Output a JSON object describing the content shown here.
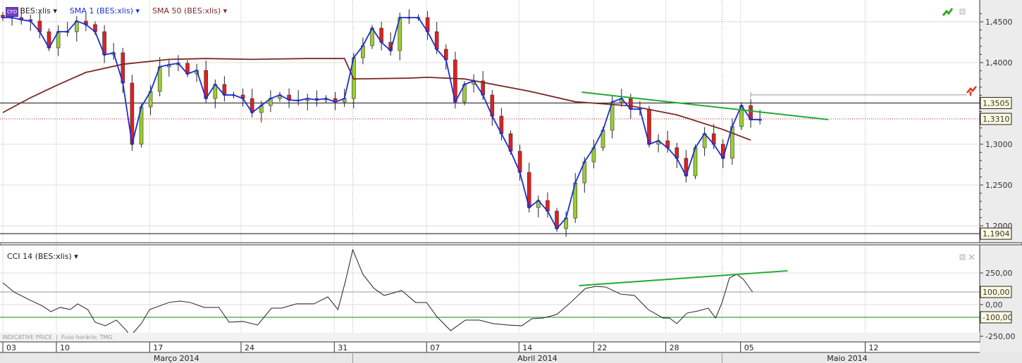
{
  "legend": {
    "badge": "CFD",
    "instrument": "BES:xlis",
    "sma1": "SMA 1 (BES:xlis)",
    "sma50": "SMA 50 (BES:xlis)",
    "arrow": "▾"
  },
  "cci_legend": "CCI 14 (BES:xlis)",
  "info": {
    "price_type": "INDICATIVE PRICE",
    "timezone": "Fuso horário: TMG"
  },
  "colors": {
    "up": "#9acd32",
    "down": "#e02020",
    "sma1": "#1a2ed8",
    "sma50": "#7a2a2a",
    "trend": "#22aa33",
    "cci": "#222222"
  },
  "chart_data": [
    {
      "type": "candlestick",
      "title": "BES:xlis",
      "ylim": [
        1.18,
        1.465
      ],
      "y_ticks": [
        "1,4500",
        "1,4000",
        "1,3000",
        "1,2500",
        "1,2000"
      ],
      "y_tick_values": [
        1.45,
        1.4,
        1.3,
        1.25,
        1.2
      ],
      "closes": [
        1.4552,
        1.4552,
        1.4526,
        1.4509,
        1.4379,
        1.4181,
        1.4379,
        1.4379,
        1.4509,
        1.4466,
        1.4379,
        1.4095,
        1.4121,
        1.375,
        1.3,
        1.3457,
        1.3647,
        1.3948,
        1.3974,
        1.3991,
        1.3862,
        1.3905,
        1.356,
        1.3733,
        1.3603,
        1.3603,
        1.356,
        1.3388,
        1.3474,
        1.356,
        1.3603,
        1.3543,
        1.3534,
        1.356,
        1.3543,
        1.356,
        1.3517,
        1.356,
        1.406,
        1.4207,
        1.4422,
        1.425,
        1.4147,
        1.4552,
        1.4552,
        1.4552,
        1.4379,
        1.4164,
        1.4034,
        1.3517,
        1.3733,
        1.3776,
        1.3603,
        1.3345,
        1.3129,
        1.2914,
        1.2655,
        1.2224,
        1.231,
        1.2181,
        1.1966,
        1.2095,
        1.2526,
        1.2784,
        1.2957,
        1.3172,
        1.3517,
        1.356,
        1.3431,
        1.3431,
        1.3,
        1.3043,
        1.2957,
        1.2828,
        1.2612,
        1.2957,
        1.3129,
        1.3,
        1.2828,
        1.3216,
        1.3474,
        1.3302,
        1.3302
      ],
      "sma50": [
        [
          0,
          1.3388
        ],
        [
          3,
          1.357
        ],
        [
          6,
          1.373
        ],
        [
          9,
          1.388
        ],
        [
          13,
          1.398
        ],
        [
          18,
          1.404
        ],
        [
          22,
          1.405
        ],
        [
          27,
          1.404
        ],
        [
          33,
          1.405
        ],
        [
          37,
          1.405
        ],
        [
          38,
          1.38
        ],
        [
          44,
          1.381
        ],
        [
          46,
          1.382
        ],
        [
          50,
          1.38
        ],
        [
          57,
          1.365
        ],
        [
          62,
          1.352
        ],
        [
          68,
          1.347
        ],
        [
          73,
          1.336
        ],
        [
          78,
          1.318
        ],
        [
          81,
          1.305
        ]
      ],
      "hlines": [
        {
          "value": 1.3505,
          "label": "1,3505",
          "style": "solid"
        },
        {
          "value": 1.331,
          "label": "1,3310",
          "style": "dotted"
        },
        {
          "value": 1.1904,
          "label": "1,1904",
          "style": "solid"
        }
      ],
      "alert_line": {
        "value": 1.3605,
        "from_bar": 81
      },
      "trendline": [
        [
          62.7,
          1.3638
        ],
        [
          89.4,
          1.3302
        ]
      ]
    },
    {
      "type": "line",
      "title": "CCI 14 (BES:xlis)",
      "ylim": [
        -330,
        330
      ],
      "y_ticks": [
        "250,00",
        "0,00",
        "-250,00"
      ],
      "y_tick_values": [
        250,
        0,
        -250
      ],
      "levels": [
        {
          "value": 100,
          "label": "100,00",
          "color": "#cc1111"
        },
        {
          "value": -100,
          "label": "-100,00",
          "color": "#118811"
        }
      ],
      "points": [
        [
          0,
          172
        ],
        [
          1.2,
          100
        ],
        [
          2.7,
          44
        ],
        [
          4.3,
          -11
        ],
        [
          5.2,
          -56
        ],
        [
          6.2,
          -22
        ],
        [
          7.3,
          -39
        ],
        [
          8.1,
          6
        ],
        [
          9.2,
          -39
        ],
        [
          10,
          -139
        ],
        [
          11.1,
          -167
        ],
        [
          12.3,
          -122
        ],
        [
          13.4,
          -206
        ],
        [
          13.8,
          -250
        ],
        [
          15,
          -150
        ],
        [
          15.9,
          -39
        ],
        [
          18,
          17
        ],
        [
          19.2,
          28
        ],
        [
          20.3,
          17
        ],
        [
          21.8,
          -22
        ],
        [
          23.4,
          -22
        ],
        [
          24.5,
          -139
        ],
        [
          26,
          -133
        ],
        [
          27.6,
          -161
        ],
        [
          29.1,
          -28
        ],
        [
          30.2,
          -28
        ],
        [
          31.8,
          6
        ],
        [
          33.7,
          6
        ],
        [
          35.2,
          61
        ],
        [
          36.3,
          -39
        ],
        [
          37.1,
          183
        ],
        [
          37.9,
          433
        ],
        [
          39,
          239
        ],
        [
          40.2,
          128
        ],
        [
          41.3,
          72
        ],
        [
          43.2,
          111
        ],
        [
          44.7,
          17
        ],
        [
          45.9,
          17
        ],
        [
          47,
          -94
        ],
        [
          48.5,
          -206
        ],
        [
          50.1,
          -122
        ],
        [
          51.6,
          -122
        ],
        [
          53.1,
          -150
        ],
        [
          54.7,
          -161
        ],
        [
          56.2,
          -167
        ],
        [
          57.3,
          -111
        ],
        [
          58.5,
          -106
        ],
        [
          60,
          -78
        ],
        [
          61.5,
          17
        ],
        [
          63.1,
          128
        ],
        [
          64.2,
          144
        ],
        [
          65.3,
          139
        ],
        [
          66.9,
          83
        ],
        [
          68.4,
          72
        ],
        [
          69.9,
          -39
        ],
        [
          71.5,
          -106
        ],
        [
          72.2,
          -106
        ],
        [
          73,
          -150
        ],
        [
          74.1,
          -67
        ],
        [
          75.3,
          -50
        ],
        [
          76.4,
          -28
        ],
        [
          77.2,
          -106
        ],
        [
          77.9,
          17
        ],
        [
          78.7,
          211
        ],
        [
          79.5,
          239
        ],
        [
          80.2,
          200
        ],
        [
          81.2,
          100
        ]
      ],
      "trendline": [
        [
          62.4,
          150
        ],
        [
          85,
          267
        ]
      ]
    },
    {
      "type": "axis",
      "dates": [
        {
          "label": "03",
          "bar": 0
        },
        {
          "label": "10",
          "bar": 5.8
        },
        {
          "label": "17",
          "bar": 15.9
        },
        {
          "label": "24",
          "bar": 25.8
        },
        {
          "label": "31",
          "bar": 35.9
        },
        {
          "label": "07",
          "bar": 45.9
        },
        {
          "label": "14",
          "bar": 55.9
        },
        {
          "label": "22",
          "bar": 64
        },
        {
          "label": "28",
          "bar": 71.8
        },
        {
          "label": "05",
          "bar": 79.9
        },
        {
          "label": "12",
          "bar": 93.4
        }
      ],
      "months": [
        {
          "label": "Março 2014",
          "start": -1,
          "end": 37.9
        },
        {
          "label": "Abril 2014",
          "start": 37.9,
          "end": 77.9
        },
        {
          "label": "Maio 2014",
          "start": 77.9,
          "end": 105
        }
      ]
    }
  ]
}
